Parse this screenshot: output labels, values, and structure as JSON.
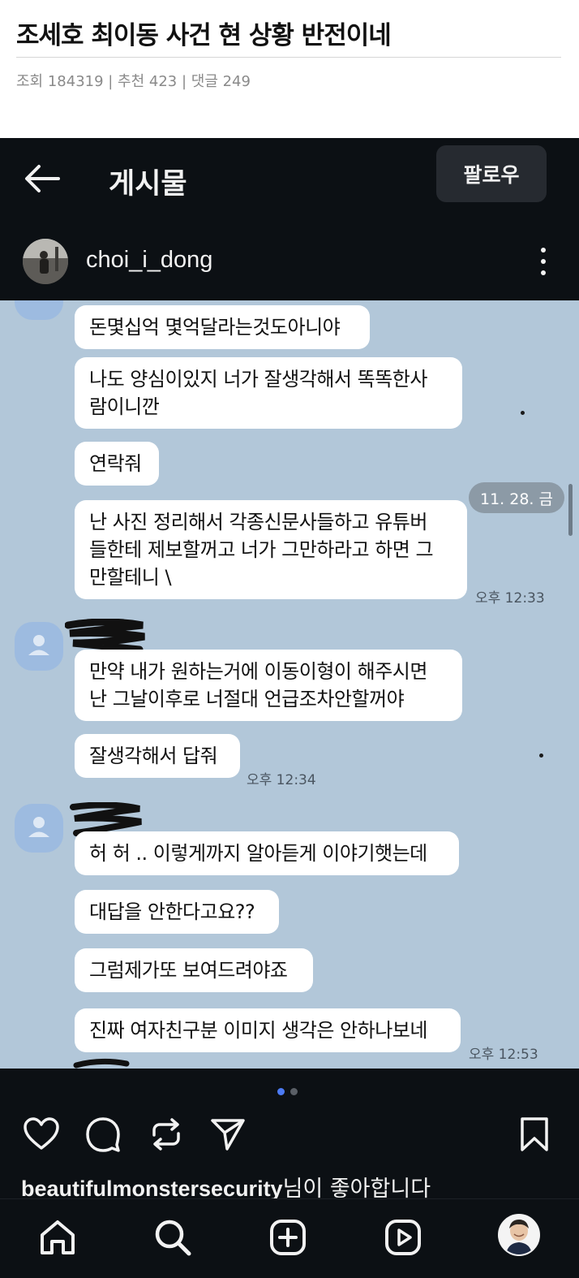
{
  "post": {
    "title": "조세호 최이동 사건 현 상황 반전이네",
    "meta": "조회 184319 | 추천 423 | 댓글 249"
  },
  "instagram": {
    "header_title": "게시물",
    "follow_label": "팔로우",
    "username": "choi_i_dong",
    "liked_by_user": "beautifulmonstersecurity",
    "liked_by_suffix": "님이 좋아합니다",
    "carousel": {
      "count": 2,
      "active_index": 0
    }
  },
  "chat": {
    "date_label": "11. 28. 금",
    "messages": [
      {
        "text": "돈몇십억 몇억달라는것도아니야"
      },
      {
        "text": "나도 양심이있지 너가 잘생각해서 똑똑한사\n람이니깐"
      },
      {
        "text": "연락줘"
      },
      {
        "text": "난 사진 정리해서 각종신문사들하고 유튜버\n들한테 제보할꺼고 너가 그만하라고 하면 그\n만할테니 \\",
        "time": "오후 12:33"
      },
      {
        "text": "만약 내가 원하는거에 이동이형이 해주시면\n난 그날이후로 너절대 언급조차안할꺼야"
      },
      {
        "text": "잘생각해서 답줘",
        "time": "오후 12:34"
      },
      {
        "text": "허 허 .. 이렇게까지 알아듣게 이야기햇는데"
      },
      {
        "text": "대답을 안한다고요??"
      },
      {
        "text": "그럼제가또 보여드려야죠"
      },
      {
        "text": "진짜 여자친구분 이미지 생각은 안하나보네",
        "time": "오후 12:53"
      }
    ]
  },
  "colors": {
    "chat_bg": "#b2c7d9",
    "ig_bg": "#0c1014",
    "carousel_active": "#4c7bf5",
    "carousel_inactive": "#5a5f66"
  },
  "icons": [
    "arrow-left-icon",
    "more-vertical-icon",
    "heart-icon",
    "comment-icon",
    "repost-icon",
    "send-icon",
    "bookmark-icon",
    "home-icon",
    "search-icon",
    "create-icon",
    "reels-icon"
  ]
}
